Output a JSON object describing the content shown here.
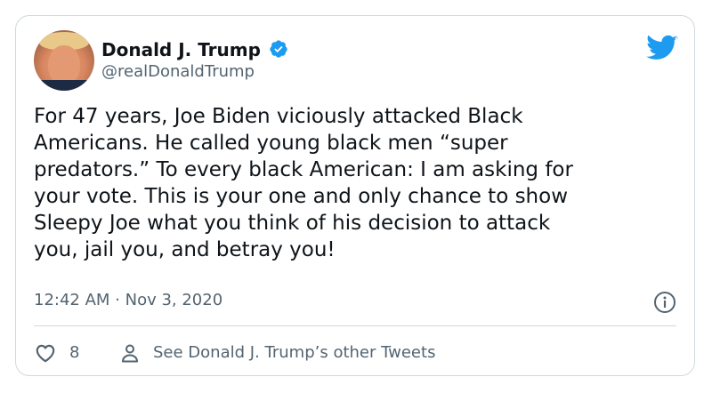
{
  "tweet": {
    "author_name": "Donald J. Trump",
    "handle": "@realDonaldTrump",
    "verified": true,
    "text": "For 47 years, Joe Biden viciously attacked Black\nAmericans. He called young black men “super\npredators.” To every black American: I am asking for\nyour vote. This is your one and only chance to show\nSleepy Joe what you think of his decision to attack\nyou, jail you, and betray you!",
    "timestamp": "12:42 AM · Nov 3, 2020",
    "like_count": "8",
    "other_tweets_label": "See Donald J. Trump’s other Tweets"
  },
  "icons": {
    "brand": "twitter-bird-icon",
    "verified": "verified-badge-icon",
    "info": "info-icon",
    "like": "heart-icon",
    "profile": "person-icon"
  },
  "colors": {
    "brand_blue": "#1d9bf0",
    "text_primary": "#0f1419",
    "text_secondary": "#536471",
    "border": "#cfd9de"
  }
}
